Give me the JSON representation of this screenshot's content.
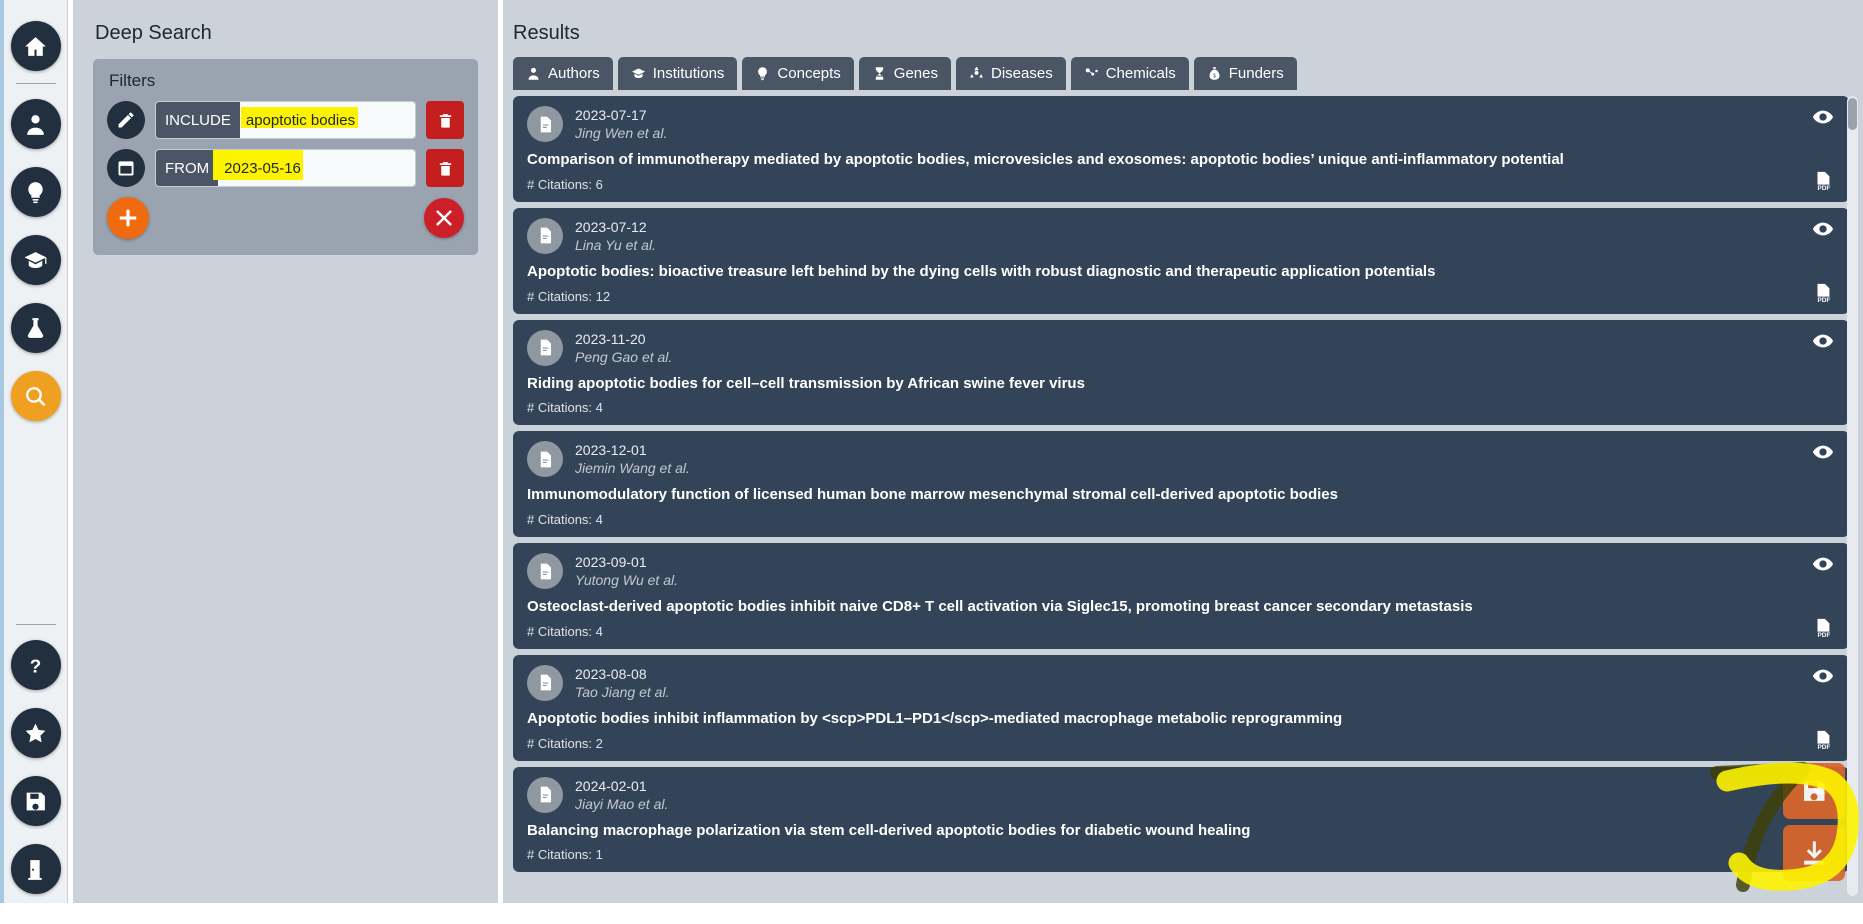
{
  "sidebar": {
    "items": [
      {
        "name": "home",
        "icon": "home-icon",
        "active": false
      },
      {
        "name": "profile",
        "icon": "user-icon",
        "active": false
      },
      {
        "name": "ideas",
        "icon": "lightbulb-icon",
        "active": false
      },
      {
        "name": "scholar",
        "icon": "graduation-cap-icon",
        "active": false
      },
      {
        "name": "lab",
        "icon": "flask-icon",
        "active": false
      },
      {
        "name": "search",
        "icon": "search-icon",
        "active": true
      },
      {
        "name": "help",
        "icon": "question-mark-icon",
        "active": false
      },
      {
        "name": "favorites",
        "icon": "star-icon",
        "active": false
      },
      {
        "name": "save",
        "icon": "floppy-disk-icon",
        "active": false
      },
      {
        "name": "logout",
        "icon": "door-exit-icon",
        "active": false
      }
    ]
  },
  "left_panel": {
    "title": "Deep Search",
    "filters_label": "Filters",
    "filters": [
      {
        "icon": "pencil-icon",
        "tag": "INCLUDE",
        "value": "apoptotic bodies",
        "highlighted": true,
        "delete_icon": "trash-icon"
      },
      {
        "icon": "calendar-icon",
        "tag": "FROM",
        "value": "2023-05-16",
        "highlighted": true,
        "delete_icon": "trash-icon"
      }
    ],
    "add_label": "+",
    "add_icon": "plus-icon",
    "clear_icon": "x-close-icon"
  },
  "results": {
    "title": "Results",
    "tabs": [
      {
        "label": "Authors",
        "icon": "person-icon"
      },
      {
        "label": "Institutions",
        "icon": "graduation-cap-icon"
      },
      {
        "label": "Concepts",
        "icon": "lightbulb-icon"
      },
      {
        "label": "Genes",
        "icon": "dna-icon"
      },
      {
        "label": "Diseases",
        "icon": "biohazard-icon"
      },
      {
        "label": "Chemicals",
        "icon": "molecule-icon"
      },
      {
        "label": "Funders",
        "icon": "money-bag-icon"
      }
    ],
    "cards": [
      {
        "date": "2023-07-17",
        "authors": "Jing Wen et al.",
        "title": "Comparison of immunotherapy mediated by apoptotic bodies, microvesicles and exosomes: apoptotic bodies’ unique anti-inflammatory potential",
        "citations": "# Citations: 6",
        "has_pdf": true
      },
      {
        "date": "2023-07-12",
        "authors": "Lina Yu et al.",
        "title": "Apoptotic bodies: bioactive treasure left behind by the dying cells with robust diagnostic and therapeutic application potentials",
        "citations": "# Citations: 12",
        "has_pdf": true
      },
      {
        "date": "2023-11-20",
        "authors": "Peng Gao et al.",
        "title": "Riding apoptotic bodies for cell–cell transmission by African swine fever virus",
        "citations": "# Citations: 4",
        "has_pdf": false
      },
      {
        "date": "2023-12-01",
        "authors": "Jiemin Wang et al.",
        "title": "Immunomodulatory function of licensed human bone marrow mesenchymal stromal cell-derived apoptotic bodies",
        "citations": "# Citations: 4",
        "has_pdf": false
      },
      {
        "date": "2023-09-01",
        "authors": "Yutong Wu et al.",
        "title": "Osteoclast-derived apoptotic bodies inhibit naive CD8+ T cell activation via Siglec15, promoting breast cancer secondary metastasis",
        "citations": "# Citations: 4",
        "has_pdf": true
      },
      {
        "date": "2023-08-08",
        "authors": "Tao Jiang et al.",
        "title": "Apoptotic bodies inhibit inflammation by <scp>PDL1–PD1</scp>-mediated macrophage metabolic reprogramming",
        "citations": "# Citations: 2",
        "has_pdf": true
      },
      {
        "date": "2024-02-01",
        "authors": "Jiayi Mao et al.",
        "title": "Balancing macrophage polarization via stem cell-derived apoptotic bodies for diabetic wound healing",
        "citations": "# Citations: 1",
        "has_pdf": false
      }
    ],
    "row_action_icons": {
      "view": "eye-icon",
      "pdf": "pdf-file-icon"
    }
  },
  "floating_actions": [
    {
      "name": "save-results",
      "icon": "floppy-disk-icon"
    },
    {
      "name": "download-results",
      "icon": "download-icon"
    }
  ],
  "annotation": {
    "shape": "handdrawn-seven",
    "color": "#fdf300"
  },
  "colors": {
    "accent_orange": "#f0a020",
    "card_bg": "#344458",
    "panel_bg": "#ccd2da",
    "tab_bg": "#4a5666",
    "danger_red": "#c31f1f",
    "highlight_yellow": "#fdf300",
    "fab_orange": "#d9662c"
  }
}
